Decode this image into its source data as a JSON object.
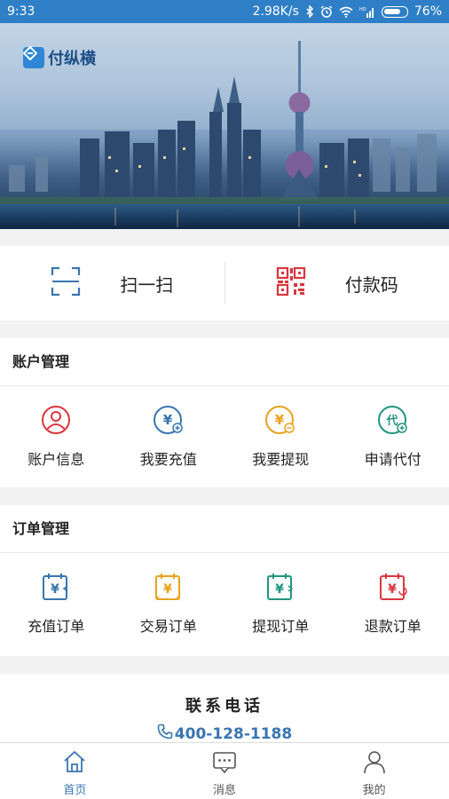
{
  "status_bar": {
    "time": "9:33",
    "net_speed": "2.98K/s",
    "battery_percent": "76%",
    "battery_level": 0.76
  },
  "banner": {
    "brand_name": "付纵横"
  },
  "quick_actions": {
    "scan_label": "扫一扫",
    "pay_code_label": "付款码"
  },
  "account_section": {
    "title": "账户管理",
    "items": [
      {
        "label": "账户信息",
        "icon": "account-info-icon"
      },
      {
        "label": "我要充值",
        "icon": "recharge-icon"
      },
      {
        "label": "我要提现",
        "icon": "withdraw-icon"
      },
      {
        "label": "申请代付",
        "icon": "proxy-pay-icon"
      }
    ]
  },
  "order_section": {
    "title": "订单管理",
    "items": [
      {
        "label": "充值订单",
        "icon": "recharge-order-icon"
      },
      {
        "label": "交易订单",
        "icon": "trade-order-icon"
      },
      {
        "label": "提现订单",
        "icon": "withdraw-order-icon"
      },
      {
        "label": "退款订单",
        "icon": "refund-order-icon"
      }
    ]
  },
  "contact": {
    "title": "联系电话",
    "phone": "400-128-1188"
  },
  "tab_bar": {
    "tabs": [
      {
        "label": "首页",
        "icon": "home-icon",
        "active": true
      },
      {
        "label": "消息",
        "icon": "message-icon",
        "active": false
      },
      {
        "label": "我的",
        "icon": "profile-icon",
        "active": false
      }
    ]
  },
  "colors": {
    "primary": "#3a75b0",
    "status_bar": "#2f7fc6",
    "red": "#d9363e",
    "orange": "#e8a21c",
    "teal": "#23957f"
  }
}
